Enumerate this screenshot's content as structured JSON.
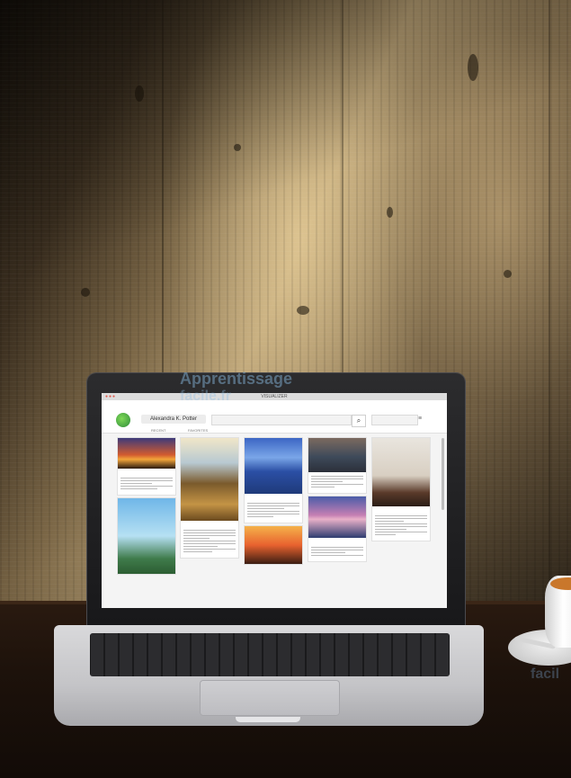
{
  "watermark": {
    "line1": "Apprentissage",
    "line2": "facile.fr",
    "corner": "facil"
  },
  "laptop_screen": {
    "window_title": "VISUALIZER",
    "profile_name": "Alexandra K. Potter",
    "nav_links": [
      "RECENT",
      "FAVORITES"
    ],
    "search_placeholder": "Search",
    "search_button_icon": "search-icon",
    "menu_icon": "menu-icon"
  },
  "colors": {
    "screen_bg": "#f4f4f4",
    "accent_green": "#2e8b3a",
    "table_wood": "#1d120b",
    "coffee": "#c9772b"
  }
}
